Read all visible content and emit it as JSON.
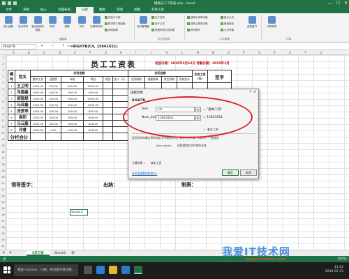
{
  "window": {
    "title": "模板员工工资表.xlsx - Excel",
    "min": "—",
    "max": "☐",
    "close": "✕"
  },
  "tabs": [
    "文件",
    "开始",
    "插入",
    "页面布局",
    "公式",
    "数据",
    "审阅",
    "视图",
    "开发工具"
  ],
  "ribbon": {
    "buttons": [
      "插入函数",
      "自动求和",
      "最近使用的函数",
      "财务",
      "逻辑",
      "文本",
      "日期和时间"
    ],
    "small": [
      "查找与引用",
      "数学和三角函数",
      "其他函数",
      "定义名称",
      "用于公式",
      "根据所选内容创建",
      "追踪引用单元格",
      "追踪从属单元格",
      "移去箭头",
      "显示公式",
      "错误检查",
      "公式求值",
      "监视窗口",
      "计算选项"
    ],
    "groups": [
      "函数库",
      "定义的名称",
      "公式审核",
      "计算"
    ],
    "name_manager": "名称管理器"
  },
  "formula_bar": {
    "name_box": "RIGHTB",
    "fx": "✕ ✓ fx",
    "formula": "=RIGHTB(C4, 15641651)"
  },
  "columns": [
    "A",
    "B",
    "C",
    "D",
    "E",
    "F",
    "G",
    "H",
    "I",
    "J",
    "K",
    "L",
    "M",
    "N",
    "O",
    "P",
    "Q",
    "R",
    "S",
    "T",
    "U"
  ],
  "rows": [
    "1",
    "2",
    "3",
    "4",
    "5",
    "6",
    "7",
    "8",
    "9",
    "10",
    "11",
    "12",
    "13",
    "14",
    "15",
    "16",
    "17",
    "18",
    "19",
    "20",
    "21",
    "22",
    "23",
    "24",
    "25",
    "26",
    "27",
    "28",
    "29",
    "30",
    "31"
  ],
  "sheet": {
    "title": "员工工资表",
    "date_line": "发放日期：2015年2月12日  考勤日期：2015年1月",
    "headers": {
      "no": "编号",
      "name": "姓名",
      "due": "应发金额",
      "deduct": "应扣金额",
      "base": "基本工资",
      "full": "全勤奖",
      "subsidy": "补助",
      "post": "岗位",
      "bonus": "奖金",
      "total": "合计（元）",
      "late": "迟到扣款",
      "absence": "缺勤扣款",
      "other": "其它扣款",
      "deduct_total": "扣款合计",
      "net": "实发工资（元）",
      "sign": "签字"
    },
    "employees": [
      {
        "no": "1",
        "name": "王卫明",
        "base": "1450.00",
        "full": "100.00",
        "subsidy": "500.00",
        "post": "1000.00"
      },
      {
        "no": "2",
        "name": "冯国鑫",
        "base": "1450.00",
        "full": "100.00",
        "subsidy": "200.00",
        "post": "900.00"
      },
      {
        "no": "3",
        "name": "郝国斌",
        "base": "1450.00",
        "full": "100.00",
        "subsidy": "300.00",
        "post": "1000.00"
      },
      {
        "no": "4",
        "name": "马亚鑫",
        "base": "1450.00",
        "full": "100.00",
        "subsidy": "100.00",
        "post": "1000.00"
      },
      {
        "no": "5",
        "name": "张爱琴",
        "base": "1450.00",
        "full": "100.00",
        "subsidy": "200.00",
        "post": "800.00"
      },
      {
        "no": "6",
        "name": "高阳",
        "base": "1450.00",
        "full": "100.00",
        "subsidy": "300.00",
        "post": "800.00"
      },
      {
        "no": "7",
        "name": "马云磊",
        "base": "1450.00",
        "full": "100.00",
        "subsidy": "200.00",
        "post": "800.00"
      },
      {
        "no": "8",
        "name": "邓睿",
        "base": "1450.00",
        "full": "0.00",
        "subsidy": "100.00",
        "post": "800.00"
      }
    ],
    "subtotal": "分栏合计",
    "sign_leader": "领导签字：",
    "sign_cashier": "出纳：",
    "sign_maker": "制表：",
    "active_cell_text": "5641651)"
  },
  "dialog": {
    "title": "函数参数",
    "help": "?",
    "close": "✕",
    "function": "RIGHTB",
    "args": [
      {
        "label": "Text",
        "value": "C4",
        "result": "= \"基本工资\""
      },
      {
        "label": "Num_bytes",
        "value": "15641651",
        "result": "= 15641651"
      }
    ],
    "extra_result": "= \"基本工资\"",
    "desc": "返回字符串最右侧的指定字节数的字符。双字节字符集（DBCS）一起使用",
    "arg_desc_label": "Num_bytes",
    "arg_desc": "所要提取的字符串的长度",
    "calc_label": "计算结果 =",
    "calc_value": "基本工资",
    "help_link": "有关该函数的帮助(H)",
    "ok": "确定",
    "cancel": "取消"
  },
  "sheet_tabs": [
    "5月工资",
    "Sheet3"
  ],
  "nav_arrows": "◀ ▶",
  "add_sheet": "⊕",
  "status": {
    "left": "点",
    "zoom": "100%"
  },
  "taskbar": {
    "search": "我是 Cortana，小娜。有问题尽管问我。",
    "time": "11:52",
    "date": "2016-02-23"
  },
  "watermark": {
    "text": "我爱IT技术网",
    "url": "jingyan.baidu.com"
  },
  "colors": {
    "excel_green": "#217346",
    "highlight_red": "#e0202a",
    "date_red": "#b00000"
  }
}
